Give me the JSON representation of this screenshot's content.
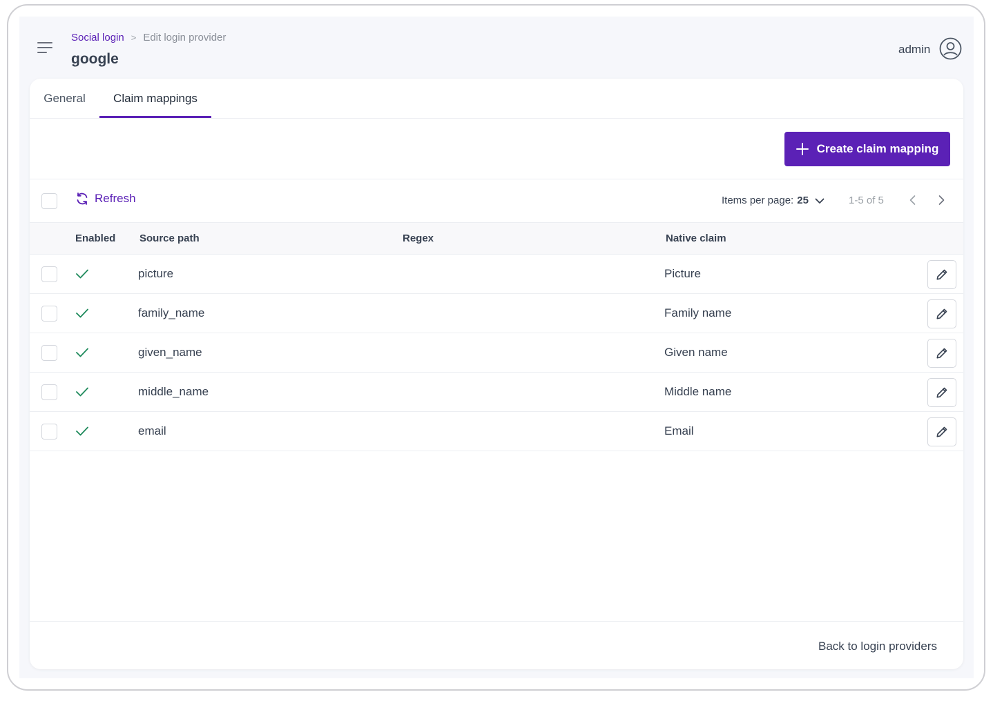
{
  "header": {
    "breadcrumb": {
      "parent": "Social login",
      "separator": ">",
      "current": "Edit login provider"
    },
    "title": "google",
    "user": "admin",
    "menu_icon": "hamburger-menu-icon",
    "avatar_icon": "user-circle-icon"
  },
  "tabs": [
    {
      "label": "General",
      "active": false
    },
    {
      "label": "Claim mappings",
      "active": true
    }
  ],
  "actions": {
    "create_label": "Create claim mapping",
    "create_icon": "plus-icon"
  },
  "toolbar": {
    "refresh_label": "Refresh",
    "refresh_icon": "refresh-icon",
    "items_per_page_label": "Items per page:",
    "items_per_page_value": "25",
    "range": "1-5 of 5"
  },
  "table": {
    "columns": [
      "Enabled",
      "Source path",
      "Regex",
      "Native claim"
    ],
    "rows": [
      {
        "enabled": true,
        "source_path": "picture",
        "regex": "",
        "native_claim": "Picture"
      },
      {
        "enabled": true,
        "source_path": "family_name",
        "regex": "",
        "native_claim": "Family name"
      },
      {
        "enabled": true,
        "source_path": "given_name",
        "regex": "",
        "native_claim": "Given name"
      },
      {
        "enabled": true,
        "source_path": "middle_name",
        "regex": "",
        "native_claim": "Middle name"
      },
      {
        "enabled": true,
        "source_path": "email",
        "regex": "",
        "native_claim": "Email"
      }
    ]
  },
  "footer": {
    "back_label": "Back to login providers"
  },
  "colors": {
    "accent": "#5b21b6",
    "check": "#1f8a5c",
    "background": "#f6f7fb"
  }
}
